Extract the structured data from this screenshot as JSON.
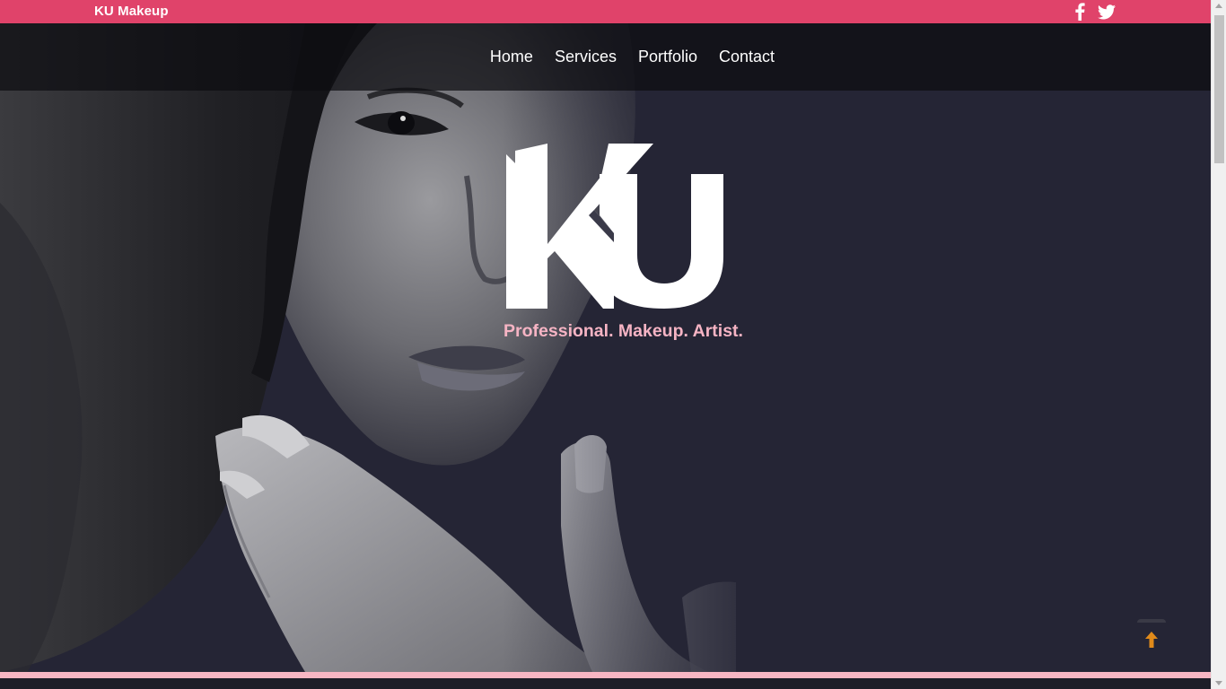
{
  "header": {
    "brand": "KU Makeup",
    "social": [
      {
        "name": "facebook-icon"
      },
      {
        "name": "twitter-icon"
      }
    ]
  },
  "nav": {
    "items": [
      {
        "label": "Home"
      },
      {
        "label": "Services"
      },
      {
        "label": "Portfolio"
      },
      {
        "label": "Contact"
      }
    ]
  },
  "hero": {
    "logo_text": "KU",
    "tagline": "Professional. Makeup. Artist."
  },
  "controls": {
    "back_to_top_icon": "arrow-up-icon"
  },
  "colors": {
    "brand_pink": "#e0436a",
    "tagline_pink": "#f6b4c4",
    "hero_bg": "#252535",
    "accent_orange": "#e08a1a"
  }
}
